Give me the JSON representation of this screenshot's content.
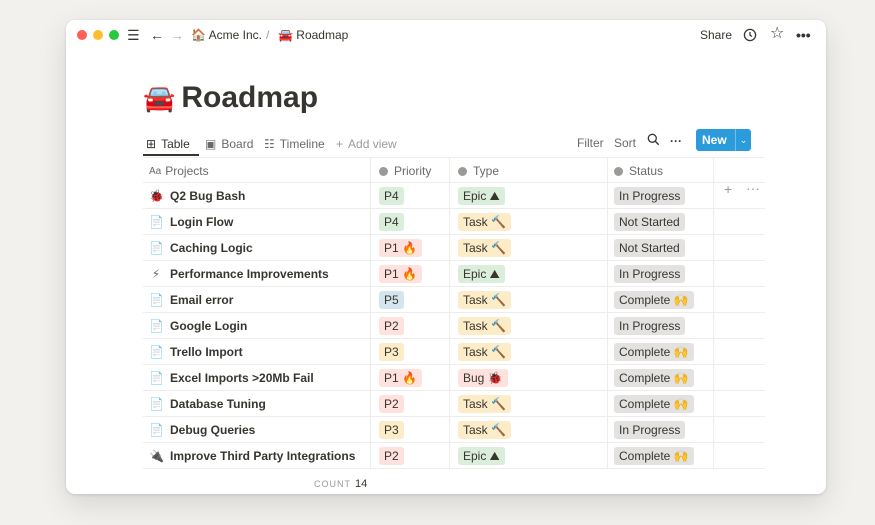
{
  "breadcrumb": {
    "workspace_emoji": "🏠",
    "workspace": "Acme Inc.",
    "separator": "/",
    "page_emoji": "🚘",
    "page": "Roadmap"
  },
  "topbar": {
    "share_label": "Share",
    "history_icon": "clock-icon",
    "favorite_icon": "star-icon",
    "more_icon": "more-icon"
  },
  "page": {
    "emoji": "🚘",
    "title": "Roadmap"
  },
  "views": [
    {
      "icon": "⊞",
      "label": "Table",
      "active": true
    },
    {
      "icon": "▣",
      "label": "Board"
    },
    {
      "icon": "☷",
      "label": "Timeline"
    },
    {
      "icon": "+",
      "label": "Add view"
    }
  ],
  "toolbar": {
    "filter_label": "Filter",
    "sort_label": "Sort",
    "new_label": "New",
    "more_label": "···"
  },
  "columns": {
    "projects": "Projects",
    "projects_icon": "Aa",
    "priority": "Priority",
    "type": "Type",
    "status": "Status"
  },
  "tag_colors": {
    "P4": "#dbeddb",
    "P1": "#ffe2dd",
    "P5": "#d3e5ef",
    "P2": "#ffe2dd",
    "P3": "#fdecc8",
    "Epic": "#dbeddb",
    "Task": "#fdecc8",
    "Bug": "#ffe2dd",
    "In Progress": "#e3e2e0",
    "Not Started": "#e3e2e0",
    "Complete": "#e3e2e0"
  },
  "rows": [
    {
      "icon": "🐞",
      "name": "Q2 Bug Bash",
      "priority": "P4",
      "priority_key": "P4",
      "type": "Epic ⛰",
      "type_key": "Epic",
      "status": "In Progress",
      "status_key": "In Progress"
    },
    {
      "icon": "📄",
      "name": "Login Flow",
      "priority": "P4",
      "priority_key": "P4",
      "type": "Task 🔨",
      "type_key": "Task",
      "status": "Not Started",
      "status_key": "Not Started"
    },
    {
      "icon": "📄",
      "name": "Caching Logic",
      "priority": "P1 🔥",
      "priority_key": "P1",
      "type": "Task 🔨",
      "type_key": "Task",
      "status": "Not Started",
      "status_key": "Not Started"
    },
    {
      "icon": "⚡",
      "name": "Performance Improvements",
      "priority": "P1 🔥",
      "priority_key": "P1",
      "type": "Epic ⛰",
      "type_key": "Epic",
      "status": "In Progress",
      "status_key": "In Progress"
    },
    {
      "icon": "📄",
      "name": "Email error",
      "priority": "P5",
      "priority_key": "P5",
      "type": "Task 🔨",
      "type_key": "Task",
      "status": "Complete 🙌",
      "status_key": "Complete"
    },
    {
      "icon": "📄",
      "name": "Google Login",
      "priority": "P2",
      "priority_key": "P2",
      "type": "Task 🔨",
      "type_key": "Task",
      "status": "In Progress",
      "status_key": "In Progress"
    },
    {
      "icon": "📄",
      "name": "Trello Import",
      "priority": "P3",
      "priority_key": "P3",
      "type": "Task 🔨",
      "type_key": "Task",
      "status": "Complete 🙌",
      "status_key": "Complete"
    },
    {
      "icon": "📄",
      "name": "Excel Imports >20Mb Fail",
      "priority": "P1 🔥",
      "priority_key": "P1",
      "type": "Bug 🐞",
      "type_key": "Bug",
      "status": "Complete 🙌",
      "status_key": "Complete"
    },
    {
      "icon": "📄",
      "name": "Database Tuning",
      "priority": "P2",
      "priority_key": "P2",
      "type": "Task 🔨",
      "type_key": "Task",
      "status": "Complete 🙌",
      "status_key": "Complete"
    },
    {
      "icon": "📄",
      "name": "Debug Queries",
      "priority": "P3",
      "priority_key": "P3",
      "type": "Task 🔨",
      "type_key": "Task",
      "status": "In Progress",
      "status_key": "In Progress"
    },
    {
      "icon": "🔌",
      "name": "Improve Third Party Integrations",
      "priority": "P2",
      "priority_key": "P2",
      "type": "Epic ⛰",
      "type_key": "Epic",
      "status": "Complete 🙌",
      "status_key": "Complete"
    }
  ],
  "footer": {
    "count_label": "COUNT",
    "count_value": "14"
  }
}
